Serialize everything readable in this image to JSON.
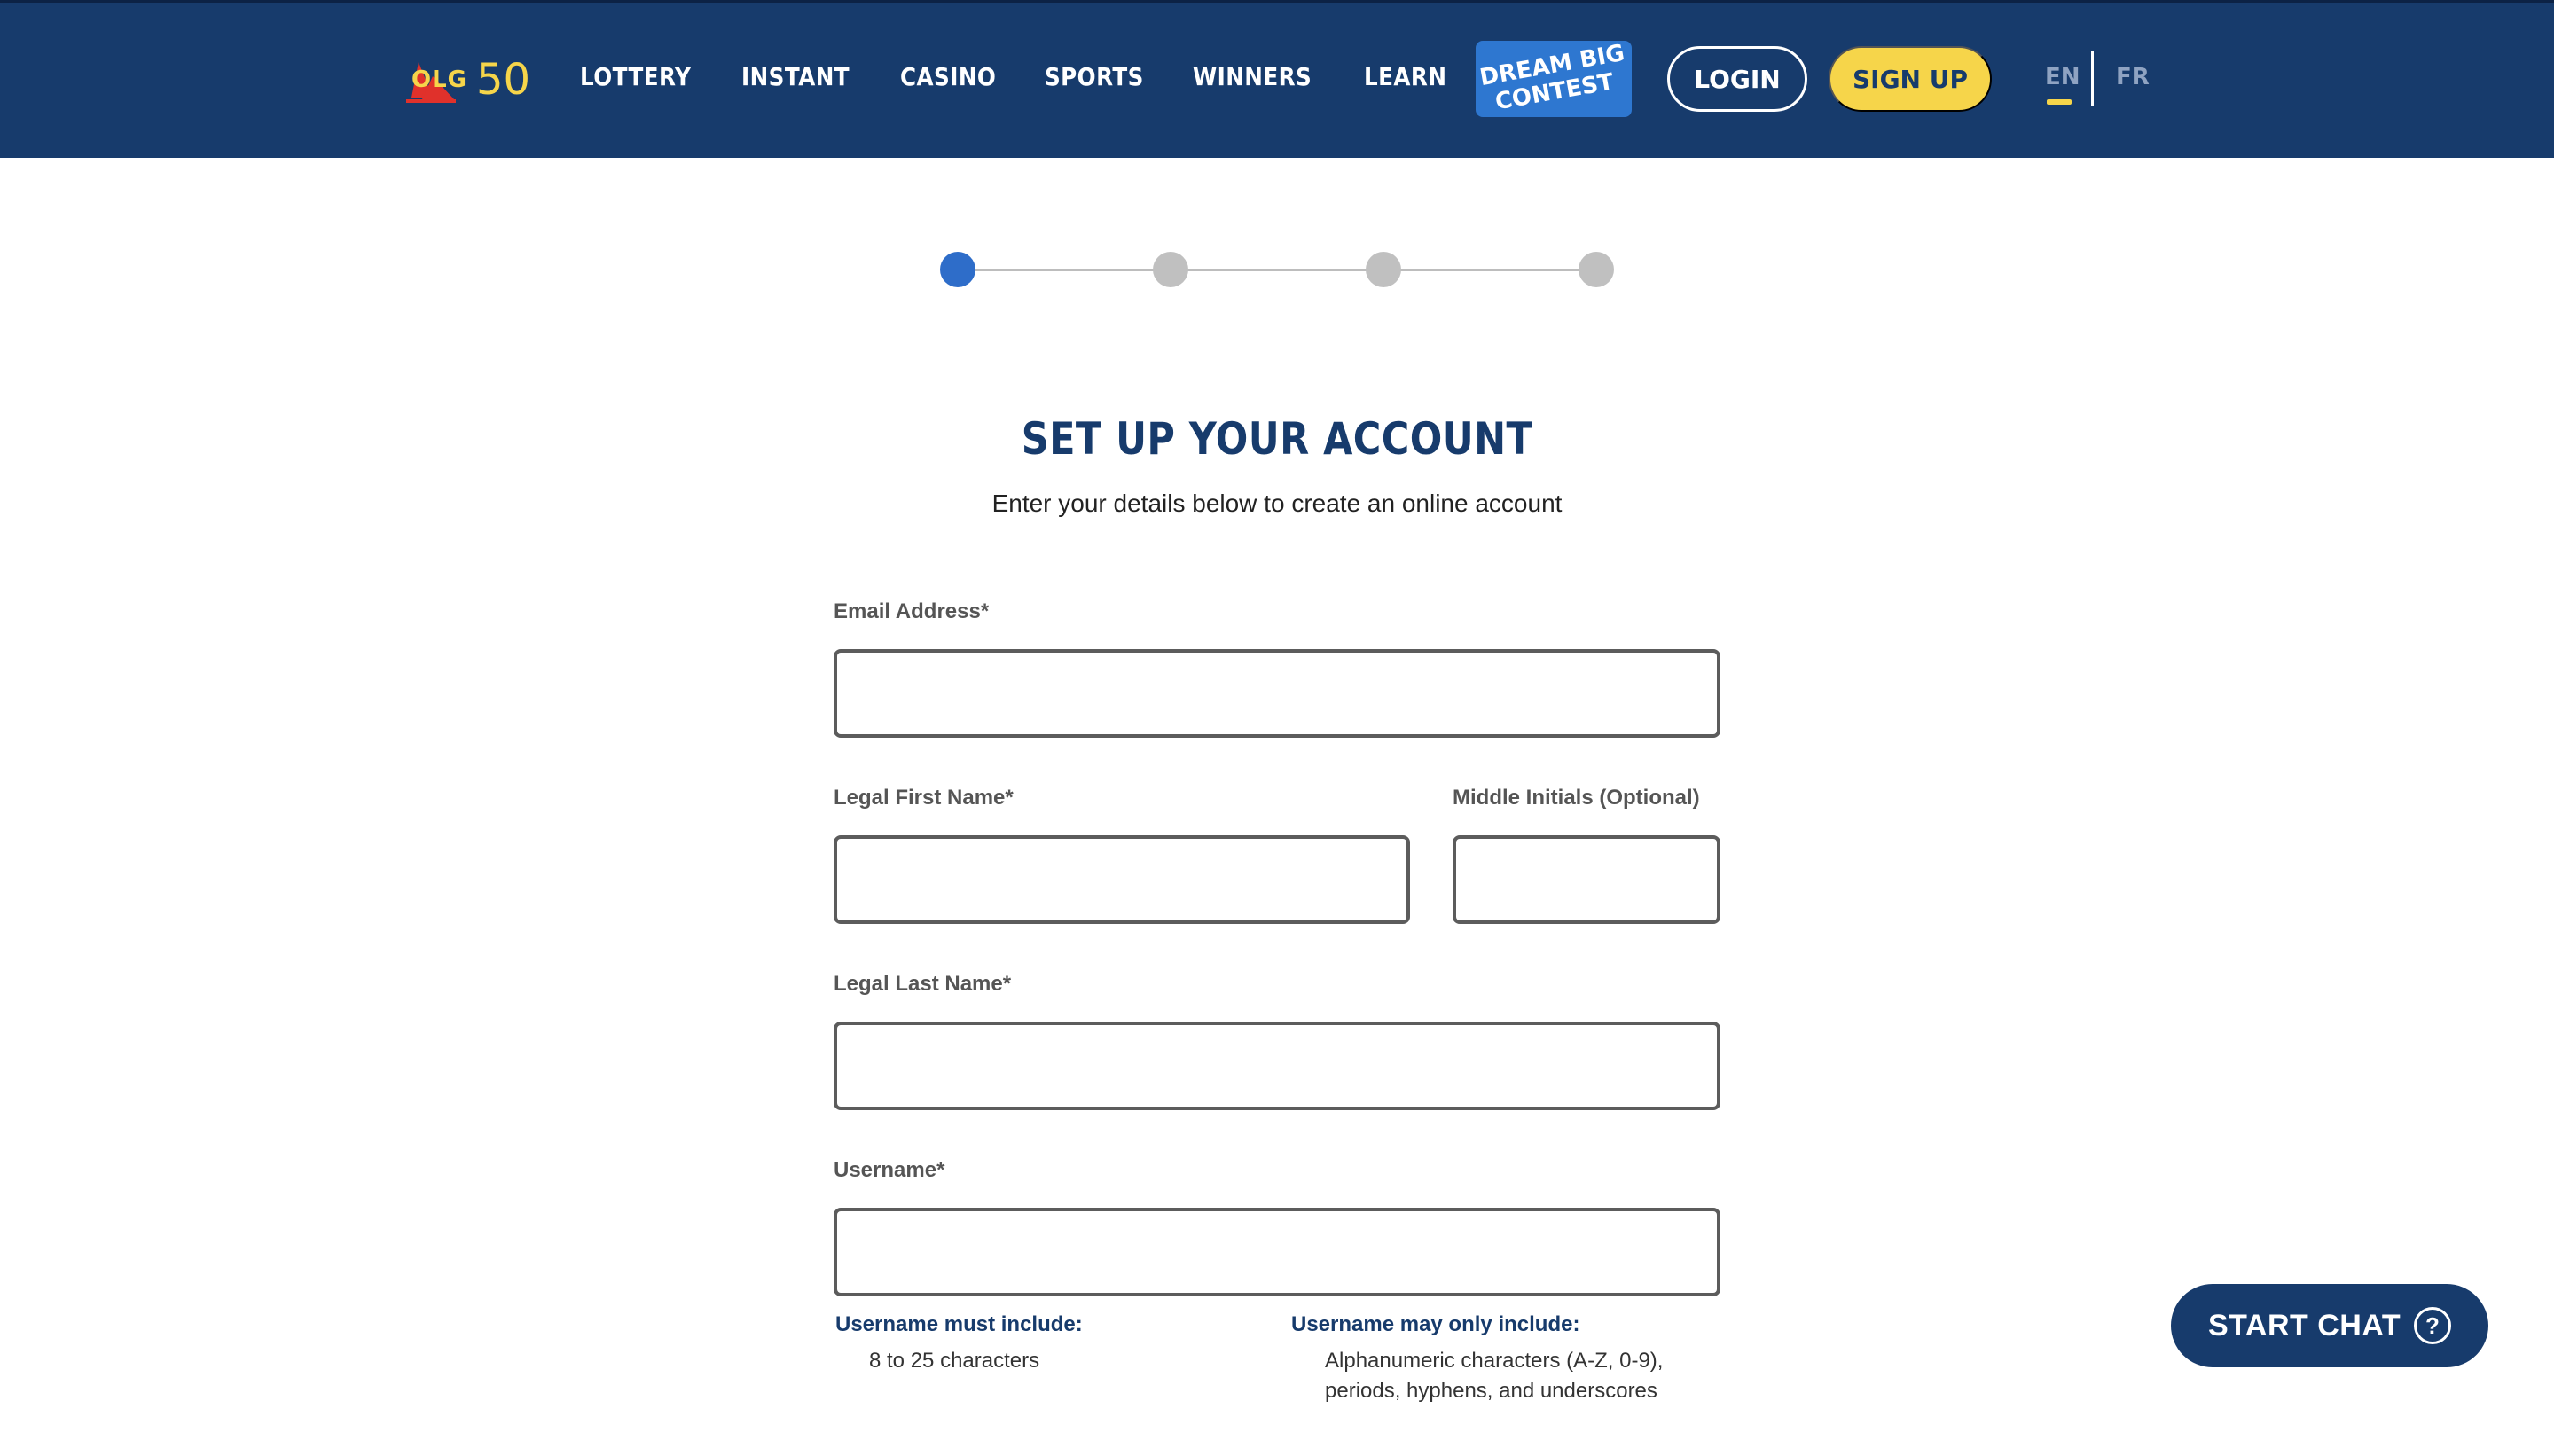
{
  "header": {
    "logo_text": "OLG",
    "logo_anniversary": "50",
    "nav": [
      "LOTTERY",
      "INSTANT",
      "CASINO",
      "SPORTS",
      "WINNERS",
      "LEARN"
    ],
    "promo": {
      "line1": "DREAM BIG",
      "line2": "CONTEST"
    },
    "login_label": "LOGIN",
    "signup_label": "SIGN UP",
    "lang_en": "EN",
    "lang_fr": "FR"
  },
  "steps": {
    "total": 4,
    "current": 1
  },
  "page": {
    "title": "SET UP YOUR ACCOUNT",
    "subtitle": "Enter your details below to create an online account"
  },
  "form": {
    "email_label": "Email Address*",
    "email_value": "",
    "first_name_label": "Legal First Name*",
    "first_name_value": "",
    "middle_label": "Middle Initials (Optional)",
    "middle_value": "",
    "last_name_label": "Legal Last Name*",
    "last_name_value": "",
    "username_label": "Username*",
    "username_value": "",
    "rules_must_title": "Username must include:",
    "rules_must_text": "8 to 25 characters",
    "rules_may_title": "Username may only include:",
    "rules_may_line1": "Alphanumeric characters (A-Z, 0-9),",
    "rules_may_line2": "periods, hyphens, and underscores"
  },
  "chat": {
    "label": "START CHAT",
    "icon": "question-icon"
  },
  "colors": {
    "navy": "#173b6c",
    "yellow": "#f6d54a",
    "blue": "#2e77d0",
    "step_active": "#2e6dc9",
    "step_inactive": "#c0c0c0"
  }
}
